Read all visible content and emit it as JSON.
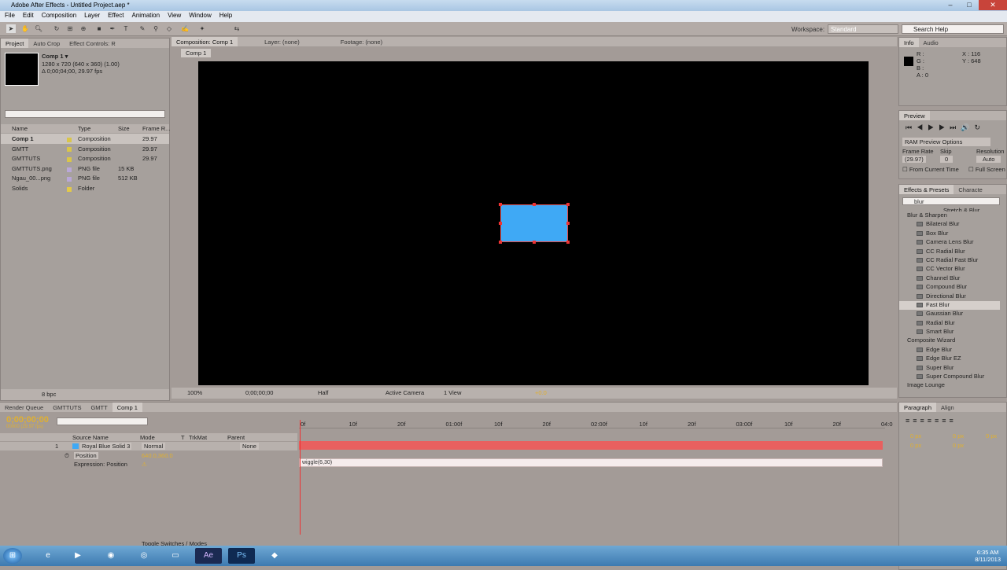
{
  "window": {
    "title": "Adobe After Effects - Untitled Project.aep *"
  },
  "menu": [
    "File",
    "Edit",
    "Composition",
    "Layer",
    "Effect",
    "Animation",
    "View",
    "Window",
    "Help"
  ],
  "workspace": {
    "label": "Workspace:",
    "value": "Standard"
  },
  "search_help": {
    "placeholder": "Search Help"
  },
  "project_panel": {
    "tabs": [
      "Project",
      "Auto Crop",
      "Effect Controls: R"
    ],
    "comp_name": "Comp 1 ▾",
    "comp_info_1": "1280 x 720 (640 x 360) (1.00)",
    "comp_info_2": "Δ 0;00;04;00, 29.97 fps",
    "columns": [
      "Name",
      "Type",
      "Size",
      "Frame R..."
    ],
    "items": [
      {
        "name": "Comp 1",
        "type": "Composition",
        "size": "",
        "fps": "29.97"
      },
      {
        "name": "GMTT",
        "type": "Composition",
        "size": "",
        "fps": "29.97"
      },
      {
        "name": "GMTTUTS",
        "type": "Composition",
        "size": "",
        "fps": "29.97"
      },
      {
        "name": "GMTTUTS.png",
        "type": "PNG file",
        "size": "15 KB",
        "fps": ""
      },
      {
        "name": "Ngau_00...png",
        "type": "PNG file",
        "size": "512 KB",
        "fps": ""
      },
      {
        "name": "Solids",
        "type": "Folder",
        "size": "",
        "fps": ""
      }
    ],
    "bpc": "8 bpc"
  },
  "viewer": {
    "tabs": [
      "Composition: Comp 1",
      "Layer: (none)",
      "Footage: (none)"
    ],
    "comp_tab": "Comp 1",
    "zoom": "100%",
    "timecode": "0;00;00;00",
    "resolution": "Half",
    "camera": "Active Camera",
    "view": "1 View",
    "offset": "+0.0"
  },
  "timeline": {
    "tabs": [
      "Render Queue",
      "GMTTUTS",
      "GMTT",
      "Comp 1"
    ],
    "timecode": "0;00;00;00",
    "fps_line": "00000 (29.97 fps)",
    "col_headers": [
      "Source Name",
      "Mode",
      "T",
      "TrkMat",
      "Parent"
    ],
    "ruler_labels": [
      "0f",
      "10f",
      "20f",
      "01:00f",
      "10f",
      "20f",
      "02:00f",
      "10f",
      "20f",
      "03:00f",
      "10f",
      "20f",
      "04:0"
    ],
    "layer": {
      "num": "1",
      "name": "Royal Blue Solid 3",
      "mode": "Normal",
      "parent": "None"
    },
    "position_label": "Position",
    "position_value": "640.0,360.0",
    "expression_label": "Expression: Position",
    "expression_text": "wiggle(6,30)",
    "footer": "Toggle Switches / Modes"
  },
  "info_panel": {
    "tabs": [
      "Info",
      "Audio"
    ],
    "r": "R :",
    "g": "G :",
    "b": "B :",
    "a": "A : 0",
    "x": "X : 116",
    "y": "Y : 648"
  },
  "preview_panel": {
    "title": "Preview",
    "ram_options": "RAM Preview Options",
    "frame_rate_label": "Frame Rate",
    "skip_label": "Skip",
    "resolution_label": "Resolution",
    "frame_rate": "(29.97)",
    "skip": "0",
    "resolution": "Auto",
    "from_current": "From Current Time",
    "full_screen": "Full Screen"
  },
  "effects_panel": {
    "tabs": [
      "Effects & Presets",
      "Characte"
    ],
    "search": "blur",
    "cut_item": "Stretch & Blur",
    "groups": [
      {
        "name": "Blur & Sharpen",
        "items": [
          "Bilateral Blur",
          "Box Blur",
          "Camera Lens Blur",
          "CC Radial Blur",
          "CC Radial Fast Blur",
          "CC Vector Blur",
          "Channel Blur",
          "Compound Blur",
          "Directional Blur",
          "Fast Blur",
          "Gaussian Blur",
          "Radial Blur",
          "Smart Blur"
        ]
      },
      {
        "name": "Composite Wizard",
        "items": [
          "Edge Blur",
          "Edge Blur EZ",
          "Super Blur",
          "Super Compound Blur"
        ]
      },
      {
        "name": "Image Lounge",
        "items": []
      }
    ],
    "selected": "Fast Blur"
  },
  "paragraph_panel": {
    "tabs": [
      "Paragraph",
      "Align"
    ],
    "px_values": [
      "0 px",
      "0 px",
      "0 px",
      "0 px",
      "0 px"
    ]
  },
  "taskbar": {
    "time": "6:35 AM",
    "date": "8/11/2013"
  }
}
